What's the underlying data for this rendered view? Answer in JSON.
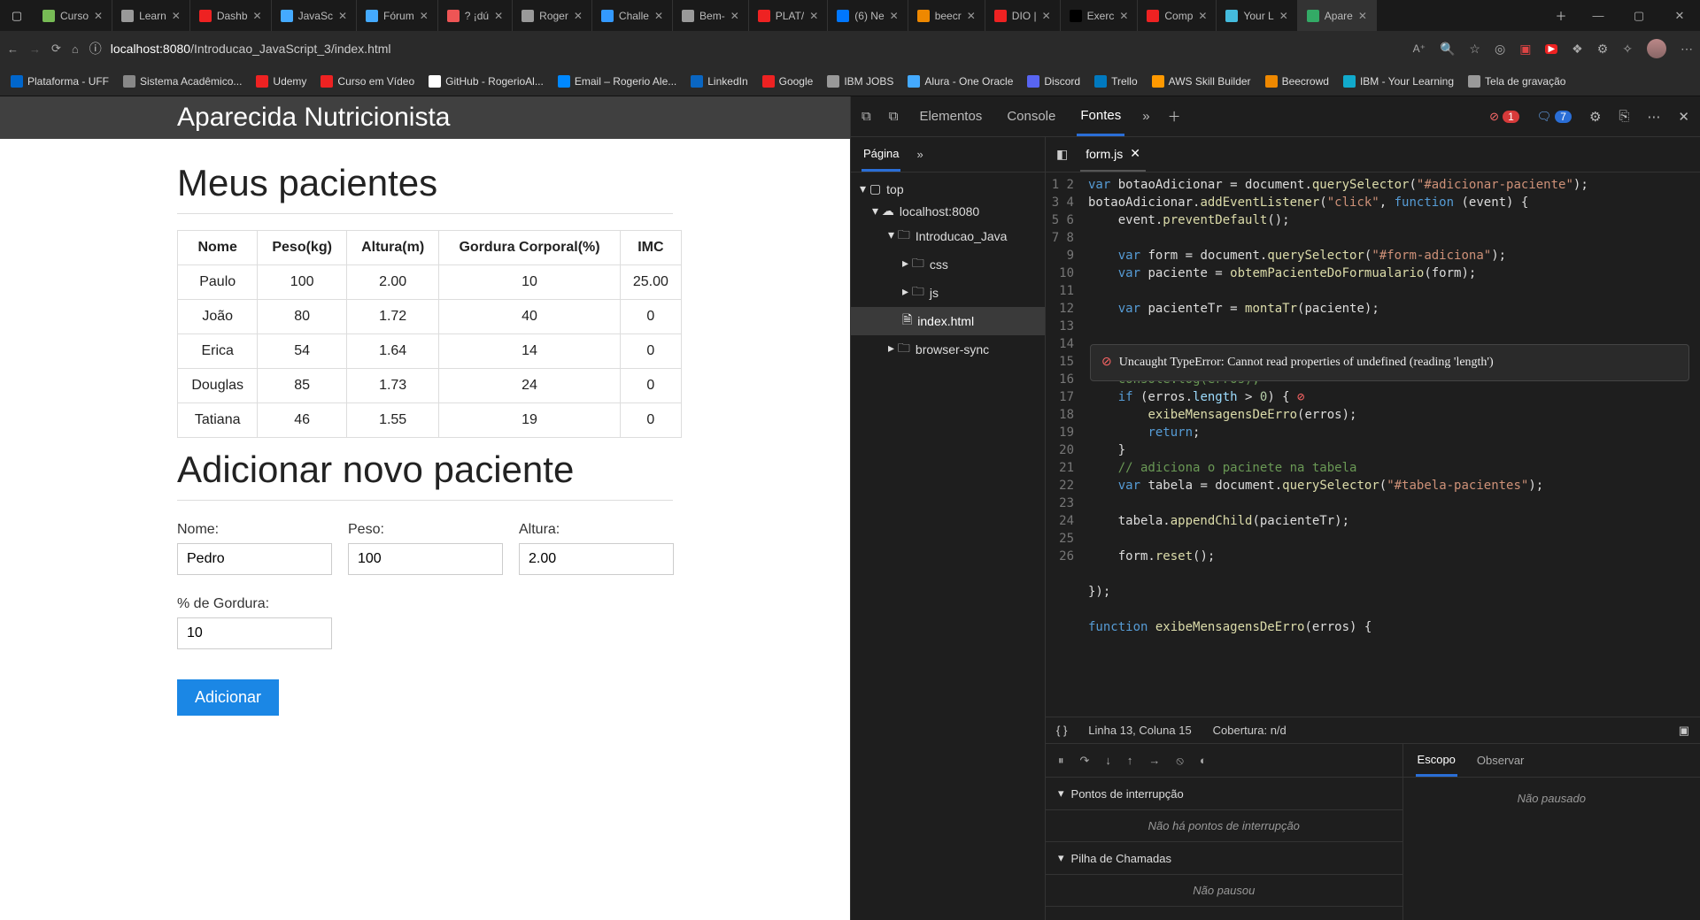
{
  "browser": {
    "tabs": [
      "Curso",
      "Learn",
      "Dashb",
      "JavaSc",
      "Fórum",
      "? ¡dú",
      "Roger",
      "Challe",
      "Bem-",
      "PLAT/",
      "(6) Ne",
      "beecr",
      "DIO |",
      "Exerc",
      "Comp",
      "Your L",
      "Apare"
    ],
    "active_tab_index": 16,
    "url_prefix": "localhost:8080",
    "url_rest": "/Introducao_JavaScript_3/index.html",
    "bookmarks": [
      "Plataforma - UFF",
      "Sistema Acadêmico...",
      "Udemy",
      "Curso em Vídeo",
      "GitHub - RogerioAl...",
      "Email – Rogerio Ale...",
      "LinkedIn",
      "Google",
      "IBM JOBS",
      "Alura - One Oracle",
      "Discord",
      "Trello",
      "AWS Skill Builder",
      "Beecrowd",
      "IBM - Your Learning",
      "Tela de gravação"
    ]
  },
  "page": {
    "title": "Aparecida Nutricionista",
    "h1": "Meus pacientes",
    "columns": [
      "Nome",
      "Peso(kg)",
      "Altura(m)",
      "Gordura Corporal(%)",
      "IMC"
    ],
    "rows": [
      {
        "n": "Paulo",
        "p": "100",
        "a": "2.00",
        "g": "10",
        "i": "25.00"
      },
      {
        "n": "João",
        "p": "80",
        "a": "1.72",
        "g": "40",
        "i": "0"
      },
      {
        "n": "Erica",
        "p": "54",
        "a": "1.64",
        "g": "14",
        "i": "0"
      },
      {
        "n": "Douglas",
        "p": "85",
        "a": "1.73",
        "g": "24",
        "i": "0"
      },
      {
        "n": "Tatiana",
        "p": "46",
        "a": "1.55",
        "g": "19",
        "i": "0"
      }
    ],
    "h2": "Adicionar novo paciente",
    "form": {
      "nome": {
        "label": "Nome:",
        "value": "Pedro"
      },
      "peso": {
        "label": "Peso:",
        "value": "100"
      },
      "altura": {
        "label": "Altura:",
        "value": "2.00"
      },
      "gordura": {
        "label": "% de Gordura:",
        "value": "10"
      },
      "submit": "Adicionar"
    }
  },
  "devtools": {
    "tabs": {
      "elements": "Elementos",
      "console": "Console",
      "sources": "Fontes"
    },
    "errors": "1",
    "warnings": "7",
    "nav": {
      "page": "Página",
      "top": "top",
      "host": "localhost:8080",
      "folder": "Introducao_Java",
      "css": "css",
      "js": "js",
      "index": "index.html",
      "bs": "browser-sync"
    },
    "file": "form.js",
    "error_msg": "Uncaught TypeError: Cannot read properties of undefined (reading 'length')",
    "status": {
      "pos": "Linha 13, Coluna 15",
      "cov": "Cobertura: n/d"
    },
    "breakpoints": {
      "title": "Pontos de interrupção",
      "empty": "Não há pontos de interrupção"
    },
    "callstack": {
      "title": "Pilha de Chamadas",
      "empty": "Não pausou"
    },
    "scope": {
      "escopo": "Escopo",
      "observar": "Observar",
      "msg": "Não pausado"
    }
  }
}
